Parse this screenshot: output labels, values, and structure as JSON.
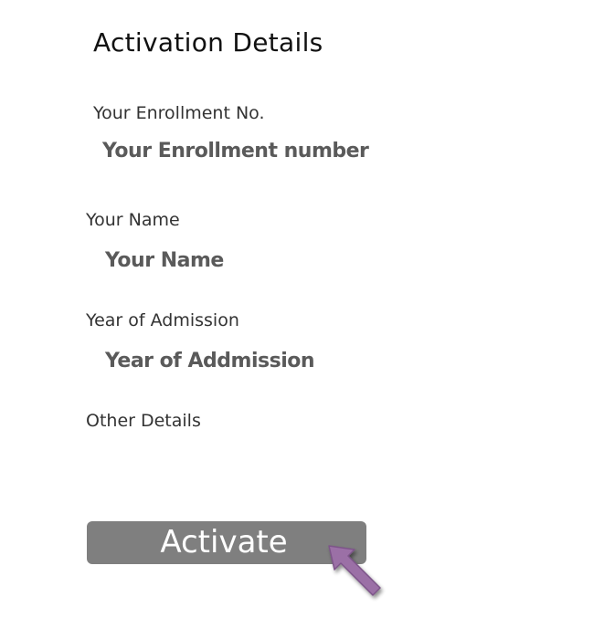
{
  "title": "Activation Details",
  "fields": {
    "enrollment": {
      "label": "Your Enrollment No.",
      "value": "Your Enrollment number"
    },
    "name": {
      "label": "Your Name",
      "value": "Your Name"
    },
    "year": {
      "label": "Year of Admission",
      "value": "Year of Addmission"
    },
    "other": {
      "label": "Other Details"
    }
  },
  "activate_button": {
    "label": "Activate"
  },
  "colors": {
    "button_bg": "#7f7f7f",
    "value_text": "#5a5a5a",
    "arrow": "#9b6fa6"
  },
  "icons": {
    "pointer": "arrow-pointer-icon"
  }
}
